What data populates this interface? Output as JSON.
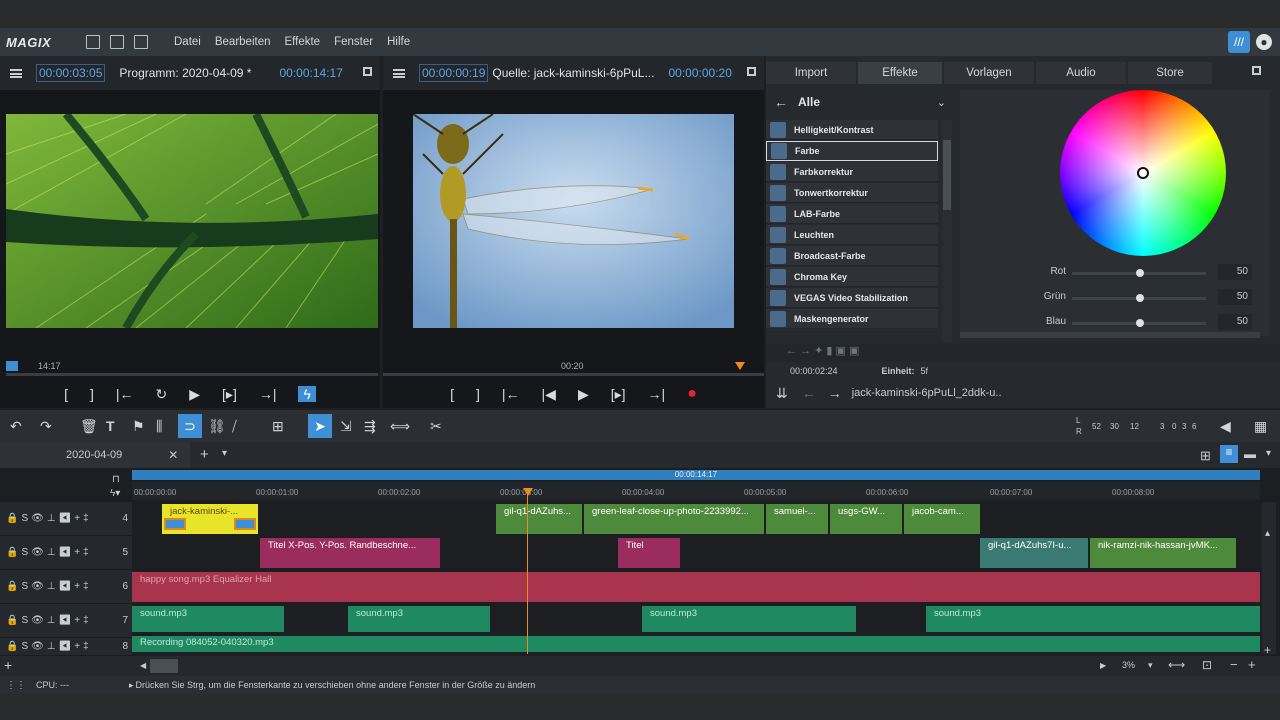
{
  "app": {
    "logo": "MAGIX"
  },
  "menu": {
    "items": [
      "Datei",
      "Bearbeiten",
      "Effekte",
      "Fenster",
      "Hilfe"
    ]
  },
  "program_monitor": {
    "timecode": "00:00:03:05",
    "title": "Programm: 2020-04-09 *",
    "duration": "00:00:14:17",
    "scrub_time": "14:17"
  },
  "source_monitor": {
    "timecode": "00:00:00:19",
    "title": "Quelle: jack-kaminski-6pPuL...",
    "duration": "00:00:00:20",
    "scrub_time": "00:20"
  },
  "right_panel": {
    "tabs": [
      "Import",
      "Effekte",
      "Vorlagen",
      "Audio",
      "Store"
    ],
    "category": "Alle",
    "effects": [
      "Helligkeit/Kontrast",
      "Farbe",
      "Farbkorrektur",
      "Tonwertkorrektur",
      "LAB-Farbe",
      "Leuchten",
      "Broadcast-Farbe",
      "Chroma Key",
      "VEGAS Video Stabilization",
      "Maskengenerator"
    ],
    "sliders": [
      {
        "label": "Rot",
        "value": "50"
      },
      {
        "label": "Grün",
        "value": "50"
      },
      {
        "label": "Blau",
        "value": "50"
      }
    ],
    "bottom_timecode": "00:00:02:24",
    "unit_label": "Einheit:",
    "unit_value": "5f",
    "filename": "jack-kaminski-6pPuLl_2ddk-u.."
  },
  "timeline": {
    "tab_name": "2020-04-09",
    "ruler_total": "00:00:14:17",
    "ruler_ticks": [
      "00:00:00:00",
      "00:00:01:00",
      "00:00:02:00",
      "00:00:03:00",
      "00:00:04:00",
      "00:00:05:00",
      "00:00:06:00",
      "00:00:07:00",
      "00:00:08:00"
    ],
    "tracks": [
      "4",
      "5",
      "6",
      "7",
      "8"
    ],
    "clips": {
      "t4": [
        "jack-kaminski-...",
        "gil-q1-dAZuhs...",
        "green-leaf-close-up-photo-2233992...",
        "samuel-...",
        "usgs-GW...",
        "jacob-cam..."
      ],
      "t5": [
        "Titel   X-Pos.  Y-Pos.  Randbeschne...",
        "Titel",
        "gil-q1-dAZuhs7I-u...",
        "nik-ramzi-nik-hassan-jvMK..."
      ],
      "t6": "happy song.mp3   Equalizer  Hall",
      "t7": [
        "sound.mp3",
        "sound.mp3",
        "sound.mp3",
        "sound.mp3"
      ],
      "t8": "Recording 084052-040320.mp3"
    },
    "zoom": "3%",
    "level_meter": [
      "52",
      "30",
      "12",
      "3",
      "0",
      "3",
      "6"
    ]
  },
  "status": {
    "cpu": "CPU: ---",
    "hint": "Drücken Sie Strg, um die Fensterkante zu verschieben ohne andere Fenster in der Größe zu ändern"
  },
  "colors": {
    "accent": "#3f8fd6",
    "playhead": "#f08a1c",
    "record": "#e8242c",
    "clip_yellow": "#e8e42a",
    "clip_green": "#4e8a3c",
    "clip_purple": "#9a2d5e",
    "clip_red": "#a8344e",
    "clip_teal": "#1f8a62"
  }
}
